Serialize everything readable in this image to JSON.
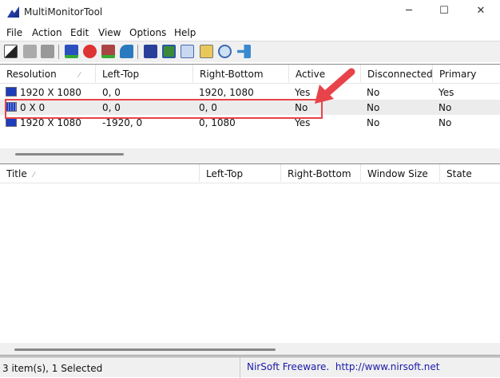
{
  "window": {
    "title": "MultiMonitorTool",
    "minimize": "─",
    "maximize": "☐",
    "close": "✕"
  },
  "menu": [
    "File",
    "Action",
    "Edit",
    "View",
    "Options",
    "Help"
  ],
  "toolbar": {
    "icons": [
      "monitor-off-icon",
      "disable-icon",
      "enable-icon",
      "set-primary-icon",
      "disable-monitor-icon",
      "switch-monitor-icon",
      "network-monitor-icon",
      "save-icon",
      "refresh-icon",
      "copy-icon",
      "properties-icon",
      "find-icon",
      "exit-icon"
    ]
  },
  "monitors": {
    "columns": [
      "Resolution",
      "Left-Top",
      "Right-Bottom",
      "Active",
      "Disconnected",
      "Primary"
    ],
    "rows": [
      {
        "resolution": "1920 X 1080",
        "left_top": "0, 0",
        "right_bottom": "1920, 1080",
        "active": "Yes",
        "disconnected": "No",
        "primary": "Yes"
      },
      {
        "resolution": "0 X 0",
        "left_top": "0, 0",
        "right_bottom": "0, 0",
        "active": "No",
        "disconnected": "No",
        "primary": "No",
        "selected": true
      },
      {
        "resolution": "1920 X 1080",
        "left_top": "-1920, 0",
        "right_bottom": "0, 1080",
        "active": "Yes",
        "disconnected": "No",
        "primary": "No"
      }
    ]
  },
  "windows": {
    "columns": [
      "Title",
      "Left-Top",
      "Right-Bottom",
      "Window Size",
      "State"
    ],
    "rows": []
  },
  "status": {
    "items": "3 item(s), 1 Selected",
    "credit": "NirSoft Freeware.  http://www.nirsoft.net"
  },
  "colors": {
    "annotation": "#e8434a",
    "link": "#1a1aa8",
    "selected_row": "#ececec"
  }
}
